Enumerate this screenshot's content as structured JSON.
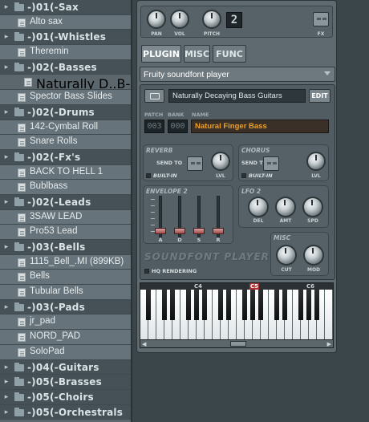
{
  "browser": {
    "items": [
      {
        "type": "folder",
        "label": "-)01(-Sax"
      },
      {
        "type": "file",
        "label": "Alto sax"
      },
      {
        "type": "folder",
        "label": "-)01(-Whistles"
      },
      {
        "type": "file",
        "label": "Theremin"
      },
      {
        "type": "folder",
        "label": "-)02(-Basses"
      },
      {
        "type": "selected",
        "label": "Naturally D..B-Guitars"
      },
      {
        "type": "file",
        "label": "Spector Bass Slides"
      },
      {
        "type": "folder",
        "label": "-)02(-Drums"
      },
      {
        "type": "file",
        "label": "142-Cymbal Roll"
      },
      {
        "type": "file",
        "label": "Snare Rolls"
      },
      {
        "type": "folder",
        "label": "-)02(-Fx's"
      },
      {
        "type": "file",
        "label": "BACK TO HELL 1"
      },
      {
        "type": "file",
        "label": "Bublbass"
      },
      {
        "type": "folder",
        "label": "-)02(-Leads"
      },
      {
        "type": "file",
        "label": "3SAW LEAD"
      },
      {
        "type": "file",
        "label": "Pro53 Lead"
      },
      {
        "type": "folder",
        "label": "-)03(-Bells"
      },
      {
        "type": "file",
        "label": "1115_Bell_.MI (899KB)"
      },
      {
        "type": "file",
        "label": "Bells"
      },
      {
        "type": "file",
        "label": "Tubular Bells"
      },
      {
        "type": "folder",
        "label": "-)03(-Pads"
      },
      {
        "type": "file",
        "label": "jr_pad"
      },
      {
        "type": "file",
        "label": "NORD_PAD"
      },
      {
        "type": "file",
        "label": "SoloPad"
      },
      {
        "type": "folder",
        "label": "-)04(-Guitars"
      },
      {
        "type": "folder",
        "label": "-)05(-Brasses"
      },
      {
        "type": "folder",
        "label": "-)05(-Choirs"
      },
      {
        "type": "folder",
        "label": "-)05(-Orchestrals"
      }
    ]
  },
  "channel": {
    "pan_label": "PAN",
    "vol_label": "VOL",
    "pitch_label": "PITCH",
    "pitch_value": "2",
    "fx_label": "FX"
  },
  "tabs": [
    {
      "label": "PLUGIN",
      "active": true
    },
    {
      "label": "MISC",
      "active": false
    },
    {
      "label": "FUNC",
      "active": false
    }
  ],
  "plugin_select": {
    "value": "Fruity soundfont player"
  },
  "soundfont": {
    "file_name": "Naturally Decaying Bass Guitars",
    "edit_label": "EDIT",
    "patch_header": "PATCH",
    "bank_header": "BANK",
    "name_header": "NAME",
    "patch_value": "003",
    "bank_value": "000",
    "name_value": "Natural Finger Bass"
  },
  "reverb": {
    "title": "REVERB",
    "send_to": "SEND TO",
    "builtin": "BUILT-IN",
    "lvl": "LVL"
  },
  "chorus": {
    "title": "CHORUS",
    "send_to": "SEND TO",
    "builtin": "BUILT-IN",
    "lvl": "LVL"
  },
  "envelope": {
    "title": "ENVELOPE 2",
    "labels": [
      "A",
      "D",
      "S",
      "R"
    ]
  },
  "lfo": {
    "title": "LFO 2",
    "labels": [
      "DEL",
      "AMT",
      "SPD"
    ]
  },
  "misc": {
    "title": "MISC",
    "labels": [
      "CUT",
      "MOD"
    ]
  },
  "branding": {
    "title": "SOUNDFONT PLAYER",
    "hq": "HQ RENDERING"
  },
  "keyboard": {
    "octave_labels": [
      "C4",
      "C5",
      "C6"
    ],
    "highlighted": "C5"
  },
  "colors": {
    "accent": "#f0a020",
    "selected_row": "#4e4048",
    "panel": "#5e6a70",
    "keycap": "#b43030"
  }
}
